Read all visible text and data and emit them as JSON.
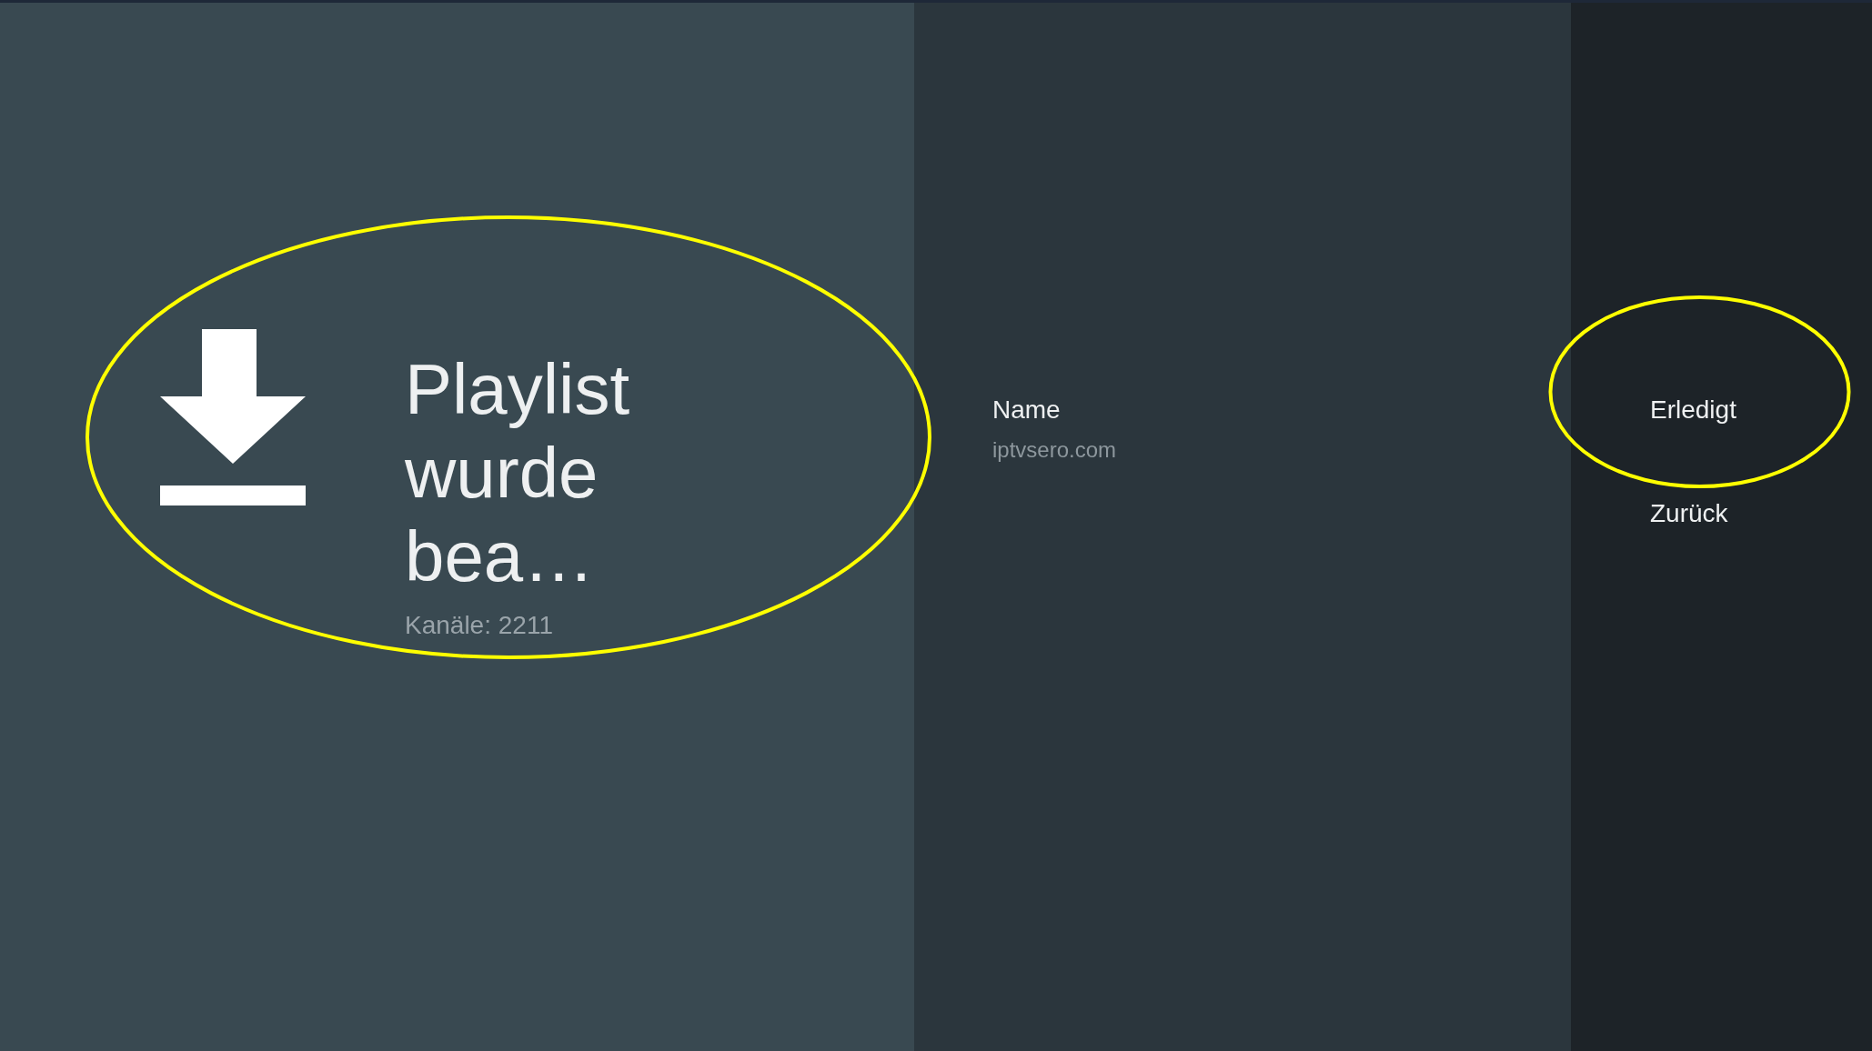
{
  "guidance": {
    "title": "Playlist wurde bea…",
    "description": "Kanäle: 2211"
  },
  "details": [
    {
      "label": "Name",
      "value": "iptvsero.com"
    }
  ],
  "actions": [
    {
      "label": "Erledigt"
    },
    {
      "label": "Zurück"
    }
  ]
}
